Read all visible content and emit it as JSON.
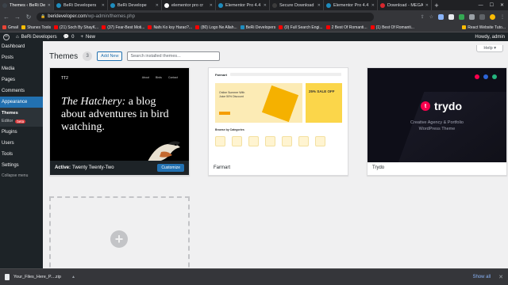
{
  "browser": {
    "tabs": [
      {
        "title": "Themes ‹ BeRi De",
        "active": true,
        "favicon_color": "#3c434a"
      },
      {
        "title": "BeRi Developers",
        "active": false,
        "favicon_color": "#1e8cbe"
      },
      {
        "title": "BeRi Develope",
        "active": false,
        "favicon_color": "#1e8cbe"
      },
      {
        "title": "elementor pro cr",
        "active": false,
        "favicon_color": "#ffffff"
      },
      {
        "title": "Elementor Pro 4.4",
        "active": false,
        "favicon_color": "#1e8cbe"
      },
      {
        "title": "Secure Download",
        "active": false,
        "favicon_color": "#3c3c3c"
      },
      {
        "title": "Elementor Pro 4.4",
        "active": false,
        "favicon_color": "#1e8cbe"
      },
      {
        "title": "Download - MEGA",
        "active": false,
        "favicon_color": "#d9272e"
      }
    ],
    "url_domain": "berideveloper.com",
    "url_path": "/wp-admin/themes.php",
    "bookmarks": [
      {
        "label": "Gmail",
        "color": "#ea4335"
      },
      {
        "label": "Shanes Tools",
        "color": "#fbbc04"
      },
      {
        "label": "(21) Soch By ShayK...",
        "color": "#ff0000"
      },
      {
        "label": "(37) Fear-Best Moti...",
        "color": "#ff0000"
      },
      {
        "label": "Nafs Ko ksy Harao?...",
        "color": "#ff0000"
      },
      {
        "label": "(80) Logo Ne Allah...",
        "color": "#ff0000"
      },
      {
        "label": "BeRi Developers",
        "color": "#1e8cbe"
      },
      {
        "label": "(0) Full Search Engi...",
        "color": "#ff0000"
      },
      {
        "label": "2 Best Of Romanti...",
        "color": "#ff0000"
      },
      {
        "label": "(1) Best Of Romanti...",
        "color": "#ff0000"
      }
    ],
    "bookmarks_right": "React Website Tuto..."
  },
  "adminbar": {
    "site_name": "BeRi Developers",
    "comments_count": "0",
    "new_label": "New",
    "howdy": "Howdy, admin"
  },
  "sidebar": {
    "items": [
      {
        "label": "Dashboard"
      },
      {
        "label": "Posts"
      },
      {
        "label": "Media"
      },
      {
        "label": "Pages"
      },
      {
        "label": "Comments"
      }
    ],
    "current": "Appearance",
    "submenu": {
      "themes": "Themes",
      "editor": "Editor",
      "beta": "beta"
    },
    "items_after": [
      {
        "label": "Plugins"
      },
      {
        "label": "Users"
      },
      {
        "label": "Tools"
      },
      {
        "label": "Settings"
      }
    ],
    "collapse": "Collapse menu"
  },
  "main": {
    "help": "Help ▾",
    "title": "Themes",
    "count": "3",
    "add_new": "Add New",
    "search_placeholder": "Search installed themes..."
  },
  "themes": {
    "active": {
      "active_label": "Active:",
      "name": "Twenty Twenty-Two",
      "customize": "Customize",
      "logo": "TT2",
      "nav": [
        "About",
        "Birds",
        "Contact"
      ],
      "headline_italic": "The Hatchery:",
      "headline_rest": " a blog about adventures in bird watching."
    },
    "farmart": {
      "name": "Farmart",
      "logo": "Farmart",
      "banner_text": "Online Summer With Juice 50% Discount",
      "sale": "25% SALE OFF",
      "cats_title": "Browse by Categories"
    },
    "trydo": {
      "name": "Trydo",
      "brand": "trydo",
      "tagline1": "Creative Agency & Portfolio",
      "tagline2": "WordPress Theme",
      "dot_colors": [
        "#f9004d",
        "#2c64d8",
        "#24b47e"
      ]
    }
  },
  "downloads": {
    "file": "Your_Files_Here_P....zip",
    "show_all": "Show all"
  }
}
